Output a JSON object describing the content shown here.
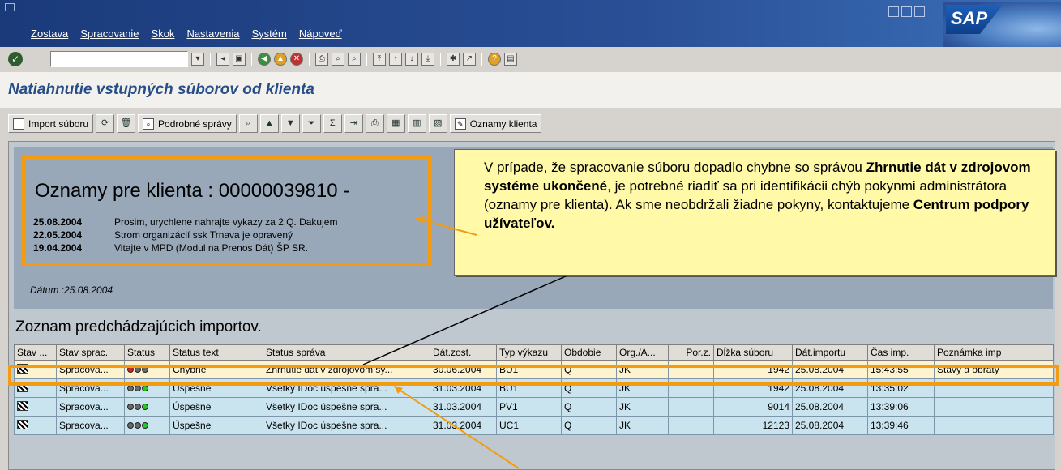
{
  "menu": [
    "Zostava",
    "Spracovanie",
    "Skok",
    "Nastavenia",
    "Systém",
    "Nápoveď"
  ],
  "brand": "SAP",
  "page_title": "Natiahnutie vstupných súborov od klienta",
  "toolbar": {
    "import_label": "Import súboru",
    "detail_label": "Podrobné správy",
    "notices_label": "Oznamy klienta"
  },
  "messages": {
    "title": "Oznamy pre klienta : 00000039810 -",
    "items": [
      {
        "date": "25.08.2004",
        "text": "Prosim, urychlene nahrajte vykazy za 2.Q. Dakujem"
      },
      {
        "date": "22.05.2004",
        "text": "Strom organizácií ssk Trnava je opravený"
      },
      {
        "date": "19.04.2004",
        "text": "Vitajte v MPD (Modul na Prenos Dát) ŠP SR."
      }
    ],
    "datum": "Dátum :25.08.2004"
  },
  "callout": {
    "p1": "V prípade, že spracovanie súboru dopadlo chybne so správou",
    "b1": "Zhrnutie dát v zdrojovom systéme ukončené",
    "p2": ", je potrebné riadiť sa pri identifikácii chýb pokynmi administrátora (oznamy pre klienta). Ak sme neobdržali žiadne pokyny, kontaktujeme",
    "b2": "Centrum podpory užívateľov."
  },
  "list": {
    "title": "Zoznam predchádzajúcich importov.",
    "columns": [
      "Stav ...",
      "Stav sprac.",
      "Status",
      "Status text",
      "Status správa",
      "Dát.zost.",
      "Typ výkazu",
      "Obdobie",
      "Org./A...",
      "Por.z.",
      "Dĺžka súboru",
      "Dát.importu",
      "Čas imp.",
      "Poznámka imp"
    ],
    "rows": [
      {
        "stav_sprac": "Spracova...",
        "status_lights": "red",
        "status_text": "Chybne",
        "status_sprava": "Zhrnutie dát v zdrojovom sy...",
        "dat_zost": "30.06.2004",
        "typ": "BU1",
        "obdobie": "Q",
        "org": "JK",
        "por": "",
        "dlzka": "1942",
        "dat_importu": "25.08.2004",
        "cas": "15:43:55",
        "poznamka": "Stavy a obraty"
      },
      {
        "stav_sprac": "Spracova...",
        "status_lights": "green",
        "status_text": "Úspešne",
        "status_sprava": "Všetky IDoc úspešne spra...",
        "dat_zost": "31.03.2004",
        "typ": "BU1",
        "obdobie": "Q",
        "org": "JK",
        "por": "",
        "dlzka": "1942",
        "dat_importu": "25.08.2004",
        "cas": "13:35:02",
        "poznamka": ""
      },
      {
        "stav_sprac": "Spracova...",
        "status_lights": "green",
        "status_text": "Úspešne",
        "status_sprava": "Všetky IDoc úspešne spra...",
        "dat_zost": "31.03.2004",
        "typ": "PV1",
        "obdobie": "Q",
        "org": "JK",
        "por": "",
        "dlzka": "9014",
        "dat_importu": "25.08.2004",
        "cas": "13:39:06",
        "poznamka": ""
      },
      {
        "stav_sprac": "Spracova...",
        "status_lights": "green",
        "status_text": "Úspešne",
        "status_sprava": "Všetky IDoc úspešne spra...",
        "dat_zost": "31.03.2004",
        "typ": "UC1",
        "obdobie": "Q",
        "org": "JK",
        "por": "",
        "dlzka": "12123",
        "dat_importu": "25.08.2004",
        "cas": "13:39:46",
        "poznamka": ""
      }
    ]
  },
  "colors": {
    "highlight": "#f39c12",
    "callout_bg": "#fff9a8",
    "title_blue": "#284e8a"
  }
}
